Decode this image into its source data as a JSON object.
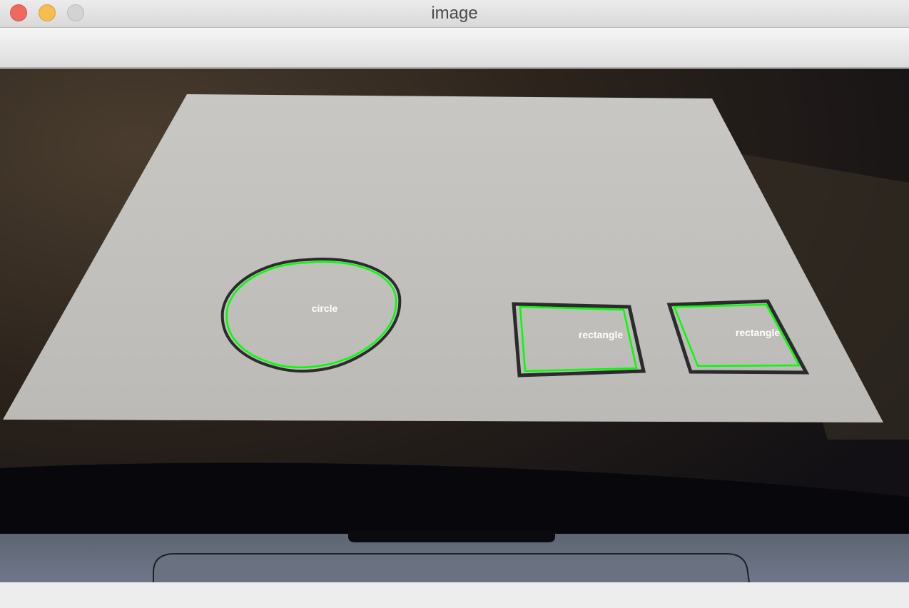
{
  "window": {
    "title": "image"
  },
  "image": {
    "labels": {
      "circle": "circle",
      "rectangle_left": "rectangle",
      "rectangle_right": "rectangle"
    },
    "colors": {
      "contour": "#00ff00",
      "paper": "#c8c6c2",
      "label_text": "#ffffff"
    }
  }
}
